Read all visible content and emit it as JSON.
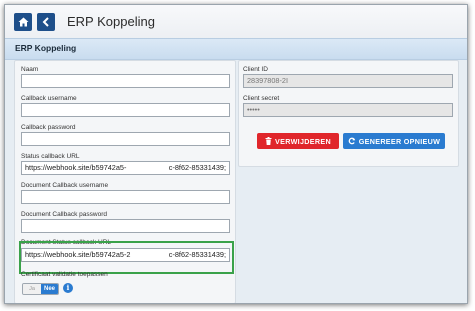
{
  "header": {
    "title": "ERP Koppeling",
    "home_icon": "home-icon",
    "back_icon": "chevron-left-icon"
  },
  "section": {
    "title": "ERP Koppeling"
  },
  "form": {
    "naam": {
      "label": "Naam",
      "value": ""
    },
    "callback_username": {
      "label": "Callback username",
      "value": ""
    },
    "callback_password": {
      "label": "Callback password",
      "value": ""
    },
    "status_callback_url": {
      "label": "Status callback URL",
      "value": "https://webhook.site/b59742a5-",
      "value_tail": "c-8f62-85331439;"
    },
    "document_callback_username": {
      "label": "Document Callback username",
      "value": ""
    },
    "document_callback_password": {
      "label": "Document Callback password",
      "value": ""
    },
    "document_status_callback_url": {
      "label": "Document Status callback URL",
      "value": "https://webhook.site/b59742a5-2",
      "value_tail": "c-8f62-85331439;"
    },
    "certificaat": {
      "label": "Certificaat validatie toepassen",
      "off_label": "Ja",
      "on_label": "Nee",
      "info_icon": "info-icon"
    }
  },
  "client": {
    "client_id": {
      "label": "Client ID",
      "value": "28397808-2I"
    },
    "client_secret": {
      "label": "Client secret",
      "value": "•••••"
    }
  },
  "buttons": {
    "delete": {
      "label": "VERWIJDEREN",
      "icon": "trash-icon"
    },
    "regenerate": {
      "label": "GENEREER OPNIEUW",
      "icon": "refresh-icon"
    }
  },
  "colors": {
    "nav_button": "#1e4f8a",
    "delete_button": "#e0262b",
    "regenerate_button": "#2a7bd0",
    "highlight_border": "#3aa24a",
    "toggle_on": "#2a7bd0"
  }
}
